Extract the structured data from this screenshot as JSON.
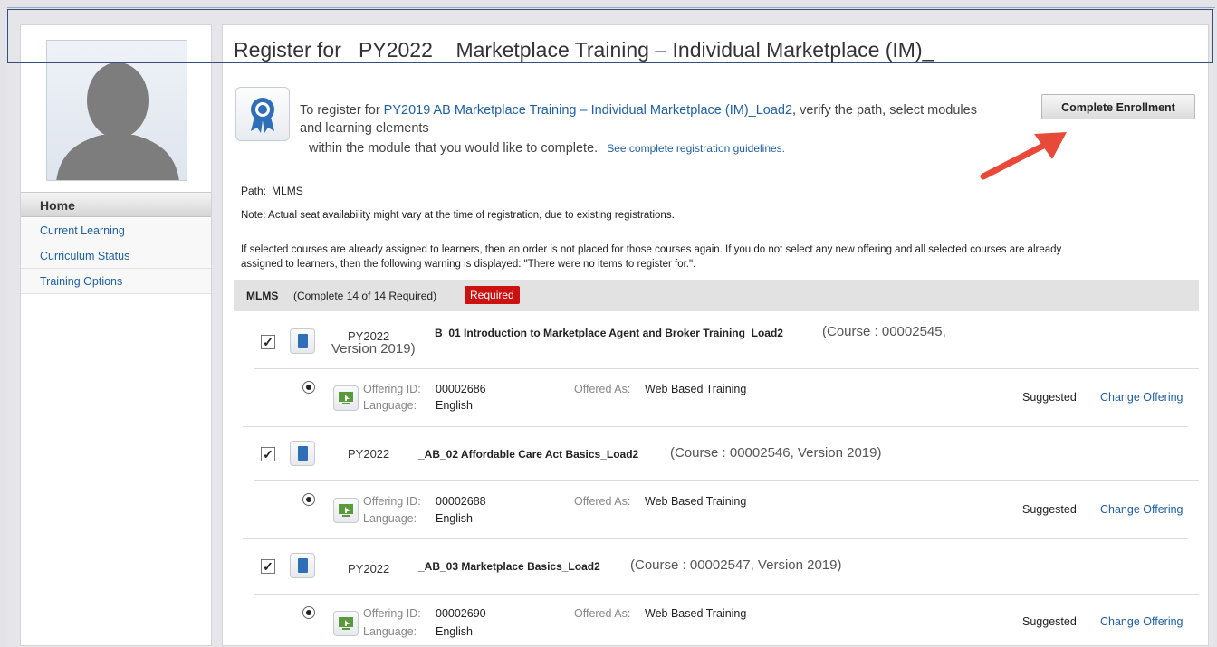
{
  "sidebar": {
    "home": "Home",
    "items": [
      {
        "label": "Current Learning"
      },
      {
        "label": "Curriculum Status"
      },
      {
        "label": "Training Options"
      }
    ]
  },
  "main": {
    "title": "Register for   PY2022    Marketplace Training – Individual Marketplace (IM)_",
    "intro_prefix": "To register for ",
    "intro_link": "PY2019 AB Marketplace Training – Individual Marketplace (IM)_Load2",
    "intro_suffix": ", verify the path, select modules and learning elements",
    "intro_line2": "within the module that you would like to complete.",
    "guidelines_link": "See complete registration guidelines.",
    "complete_button": "Complete Enrollment",
    "path_label": "Path:",
    "path_value": "MLMS",
    "note": "Note: Actual seat availability might vary at the time of registration, due to existing registrations.",
    "paragraph": "If selected courses are already assigned to learners, then an order is not placed for those courses again. If you do not select any new offering and all selected courses are already assigned to learners, then the following warning is displayed: \"There were no items to register for.\"."
  },
  "mlms": {
    "name": "MLMS",
    "status": "(Complete 14 of 14 Required)",
    "badge": "Required"
  },
  "labels": {
    "offering_id": "Offering ID:",
    "language": "Language:",
    "offered_as": "Offered As:",
    "suggested": "Suggested",
    "change_offering": "Change Offering"
  },
  "courses": [
    {
      "prefix": "PY2022",
      "name": "B_01 Introduction to Marketplace Agent and Broker Training_Load2",
      "meta": "(Course : 00002545,",
      "meta2": "Version 2019)",
      "offering_id": "00002686",
      "language": "English",
      "offered_as": "Web Based Training"
    },
    {
      "prefix": "PY2022",
      "name": "_AB_02 Affordable Care Act Basics_Load2",
      "meta": "(Course : 00002546, Version 2019)",
      "offering_id": "00002688",
      "language": "English",
      "offered_as": "Web Based Training"
    },
    {
      "prefix": "PY2022",
      "name": "_AB_03 Marketplace Basics_Load2",
      "meta": "(Course : 00002547, Version 2019)",
      "offering_id": "00002690",
      "language": "English",
      "offered_as": "Web Based Training"
    }
  ]
}
